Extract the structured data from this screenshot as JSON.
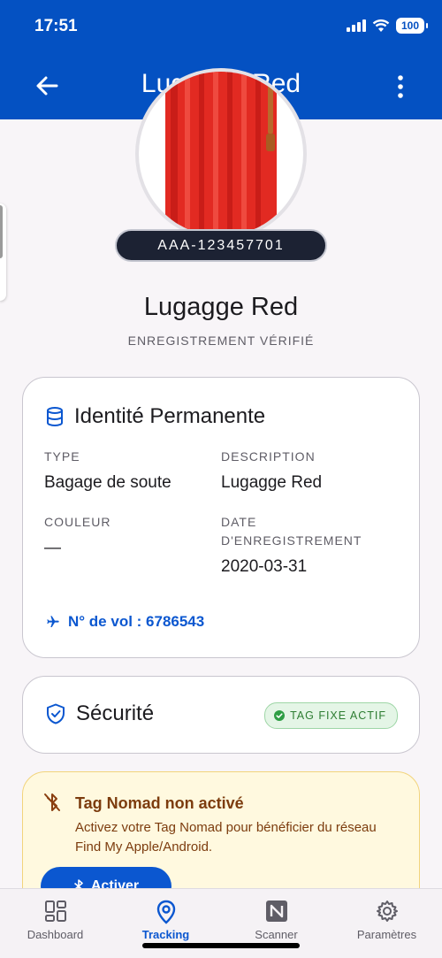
{
  "status_bar": {
    "time": "17:51",
    "battery": "100"
  },
  "header": {
    "title": "Lugagge Red",
    "back_icon": "arrow-back-icon",
    "menu_icon": "more-vert-icon"
  },
  "item": {
    "tag_id": "AAA-123457701",
    "name": "Lugagge Red",
    "verification": "ENREGISTREMENT VÉRIFIÉ",
    "photo_color": "#e22a22"
  },
  "identity_card": {
    "title": "Identité Permanente",
    "icon": "database-icon",
    "type_label": "TYPE",
    "type_value": "Bagage de soute",
    "description_label": "DESCRIPTION",
    "description_value": "Lugagge Red",
    "color_label": "COULEUR",
    "color_value": "—",
    "date_label": "DATE\nD'ENREGISTREMENT",
    "date_value": "2020-03-31",
    "flight_text": "N° de vol : 6786543",
    "flight_icon": "airplane-icon"
  },
  "security_card": {
    "title": "Sécurité",
    "icon": "shield-icon",
    "badge": "TAG FIXE ACTIF",
    "badge_color": "#2e7d32"
  },
  "nomad_card": {
    "title": "Tag Nomad non activé",
    "description": "Activez votre Tag Nomad pour bénéficier du réseau Find My Apple/Android.",
    "button_label": "Activer",
    "icon": "bluetooth-disabled-icon"
  },
  "bottom_nav": {
    "items": [
      {
        "label": "Dashboard",
        "icon": "dashboard-icon"
      },
      {
        "label": "Tracking",
        "icon": "location-pin-icon",
        "active": true
      },
      {
        "label": "Scanner",
        "icon": "nfc-icon"
      },
      {
        "label": "Paramètres",
        "icon": "gear-icon"
      }
    ]
  },
  "colors": {
    "primary": "#0451c2",
    "accent": "#0b57d0",
    "warning_bg": "#fff9df"
  }
}
